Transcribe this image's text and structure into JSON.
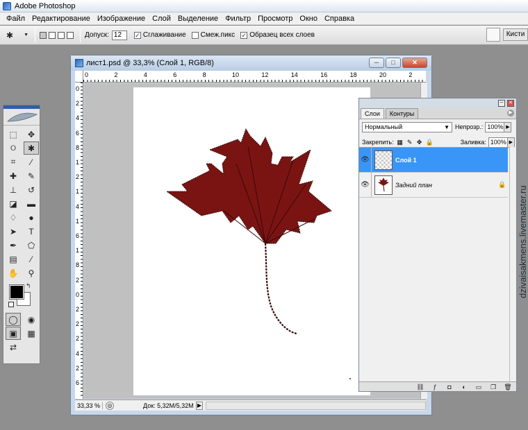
{
  "app": {
    "title": "Adobe Photoshop"
  },
  "menu": [
    "Файл",
    "Редактирование",
    "Изображение",
    "Слой",
    "Выделение",
    "Фильтр",
    "Просмотр",
    "Окно",
    "Справка"
  ],
  "options": {
    "tolerance_label": "Допуск:",
    "tolerance_value": "12",
    "antialias_label": "Сглаживание",
    "antialias_checked": true,
    "contiguous_label": "Смеж.пикс",
    "contiguous_checked": false,
    "sample_all_label": "Образец всех слоев",
    "sample_all_checked": true,
    "brushes_tab": "Кисти"
  },
  "document": {
    "title": "лист1.psd @ 33,3% (Слой 1, RGB/8)",
    "ruler_h": [
      "0",
      "2",
      "4",
      "6",
      "8",
      "10",
      "12",
      "14",
      "16",
      "18",
      "20",
      "2"
    ],
    "ruler_v": [
      "0",
      "2",
      "4",
      "6",
      "8",
      "1",
      "2",
      "1",
      "4",
      "1",
      "6",
      "1",
      "8",
      "2",
      "0",
      "2",
      "2",
      "2",
      "4",
      "2",
      "6"
    ],
    "zoom": "33,33 %",
    "doc_size": "Док: 5,32M/5,32M"
  },
  "layers_panel": {
    "tabs": [
      "Слои",
      "Контуры"
    ],
    "blend_mode": "Нормальный",
    "opacity_label": "Непрозр.:",
    "opacity_value": "100%",
    "lock_label": "Закрепить:",
    "fill_label": "Заливка:",
    "fill_value": "100%",
    "layers": [
      {
        "name": "Слой 1",
        "selected": true
      },
      {
        "name": "Задний план",
        "selected": false,
        "locked": true
      }
    ]
  },
  "watermark": "dzivaisakmens.livemaster.ru",
  "colors": {
    "leaf": "#7a1412",
    "selected_layer": "#3996f8",
    "arrow": "#5a0b0b"
  }
}
